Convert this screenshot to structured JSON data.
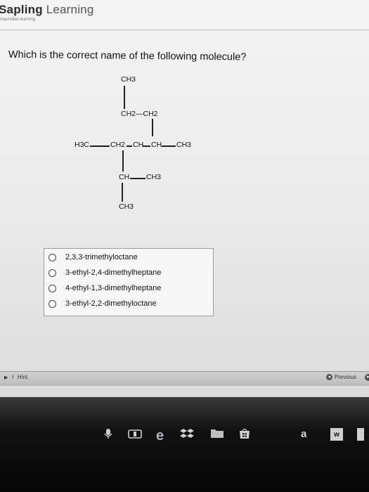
{
  "logo": {
    "brand_a": "Sapling",
    "brand_b": " Learning",
    "sub": "macmillan learning"
  },
  "question": "Which is the correct name of the following molecule?",
  "molecule": {
    "labels": [
      "CH3",
      "CH2—CH2",
      "H3C",
      "CH2",
      "CH",
      "CH",
      "CH3",
      "CH",
      "CH3",
      "CH3"
    ]
  },
  "options": [
    "2,3,3-trimethyloctane",
    "3-ethyl-2,4-dimethylheptane",
    "4-ethyl-1,3-dimethylheptane",
    "3-ethyl-2,2-dimethyloctane"
  ],
  "hint_label": "Hint",
  "previous_label": "Previous",
  "taskbar": {
    "icons": [
      "microphone-icon",
      "camera-icon",
      "edge-browser-icon",
      "dropbox-icon",
      "folder-icon",
      "store-icon",
      "amazon-icon",
      "word-icon"
    ],
    "amazon_glyph": "a",
    "word_glyph": "w"
  }
}
